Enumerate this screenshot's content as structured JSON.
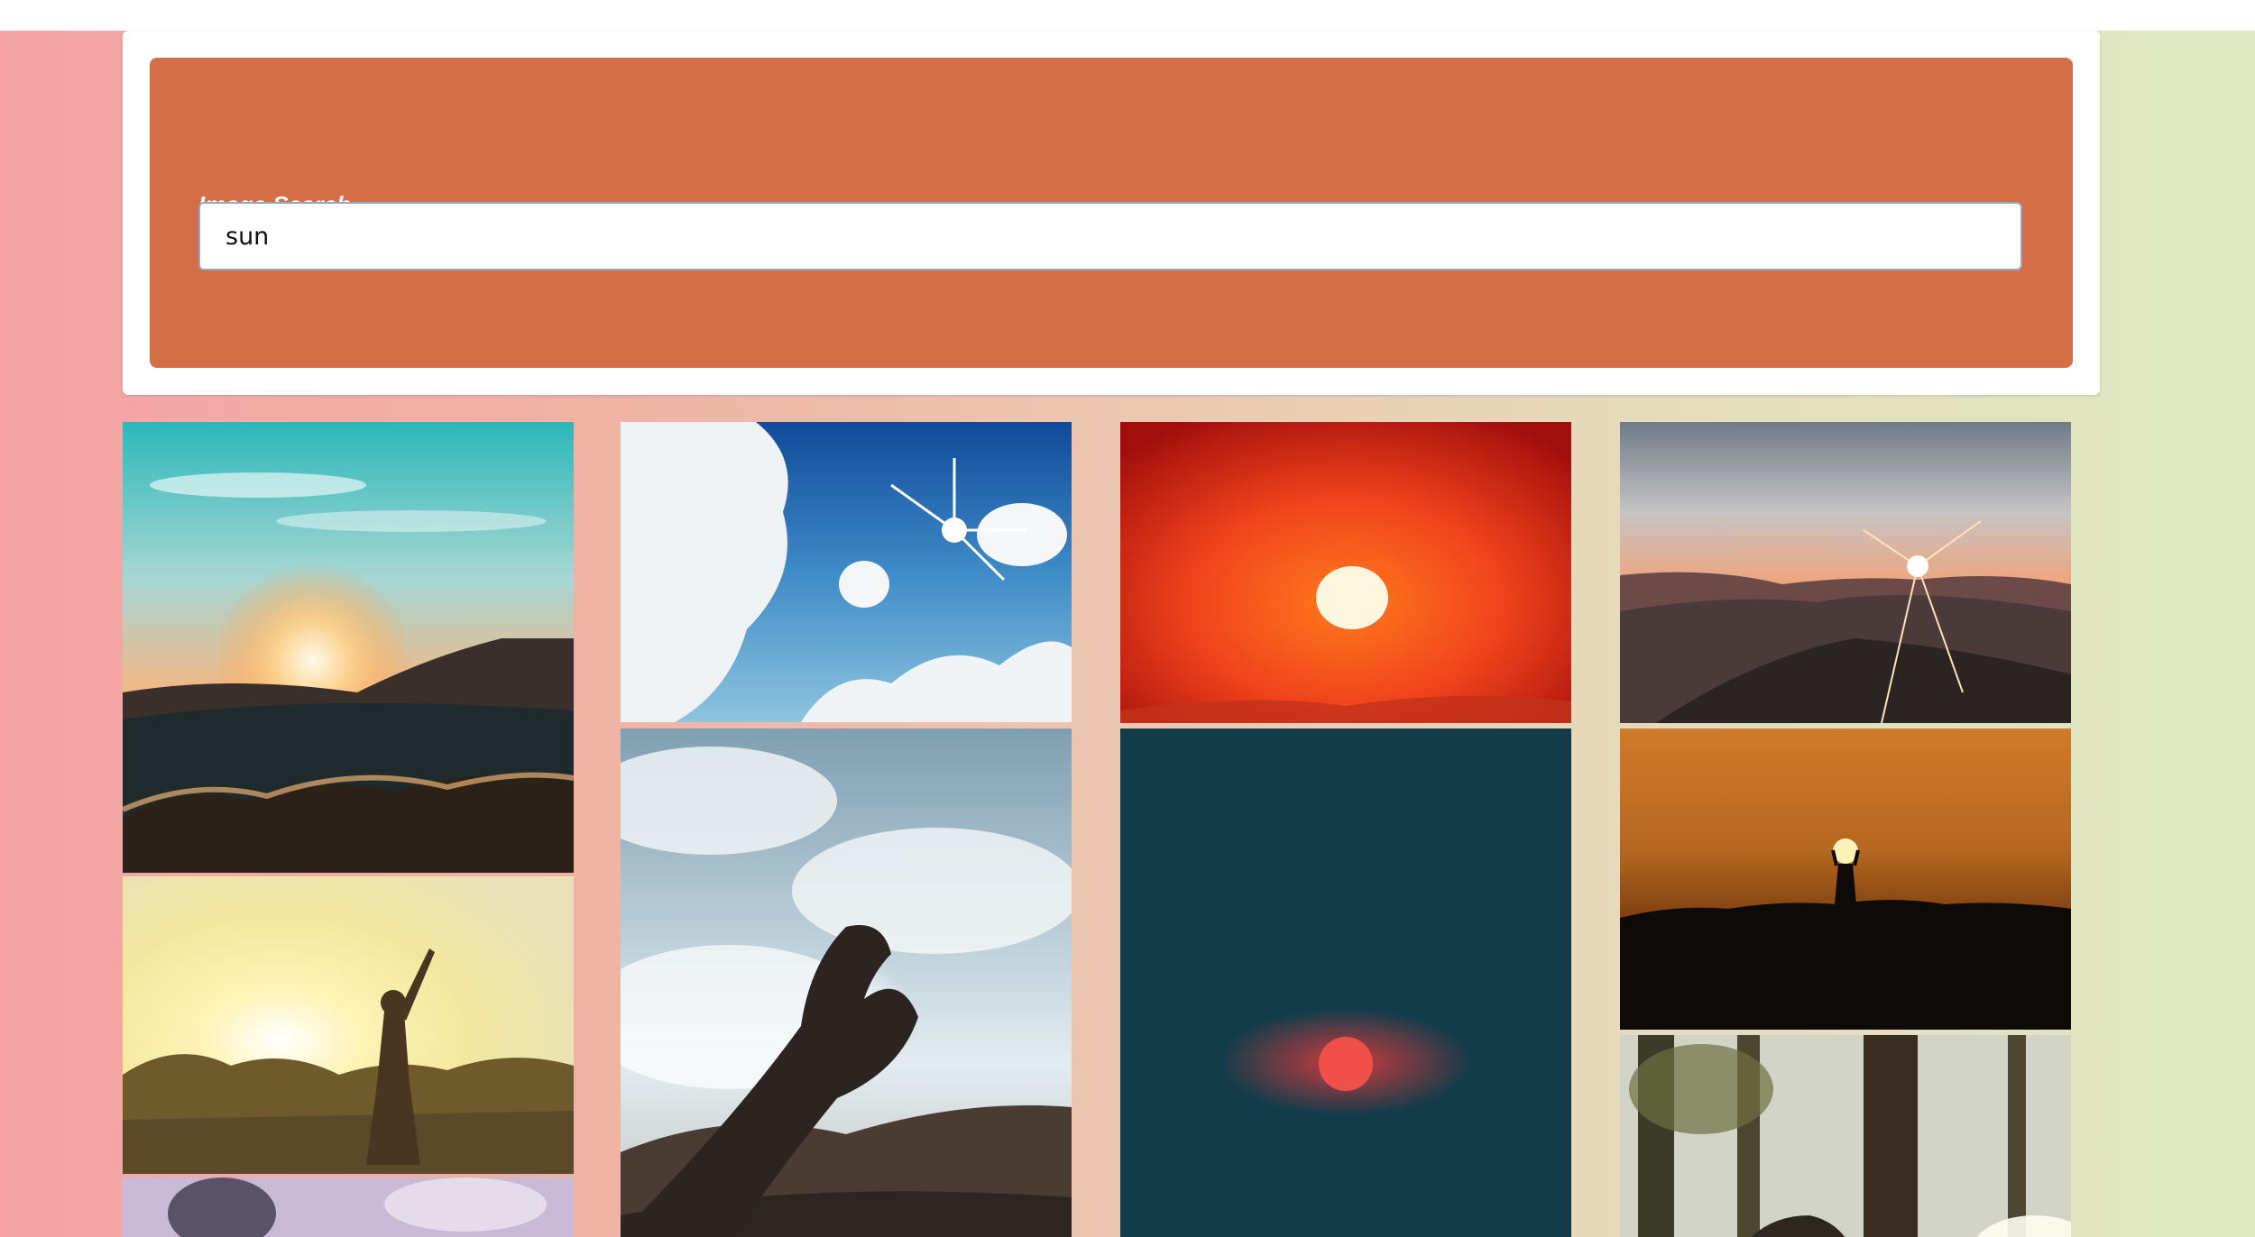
{
  "search": {
    "label": "Image Search",
    "value": "sun"
  },
  "results": {
    "col1": [
      {
        "icon": "sunset-hills-photo"
      },
      {
        "icon": "woman-sunlight-photo"
      },
      {
        "icon": "sky-clouds-photo"
      }
    ],
    "col2": [
      {
        "icon": "blue-sky-sunburst-photo"
      },
      {
        "icon": "hand-holding-sun-photo"
      }
    ],
    "col3": [
      {
        "icon": "red-sun-orange-sky-photo"
      },
      {
        "icon": "red-sun-teal-sky-photo"
      }
    ],
    "col4": [
      {
        "icon": "mountain-sunstar-photo"
      },
      {
        "icon": "silhouette-holding-sun-photo"
      },
      {
        "icon": "forest-sunlight-photo"
      }
    ]
  },
  "colors": {
    "panel": "#d36e47",
    "bg_left": "#f5a3a5",
    "bg_right": "#dfeac2"
  }
}
